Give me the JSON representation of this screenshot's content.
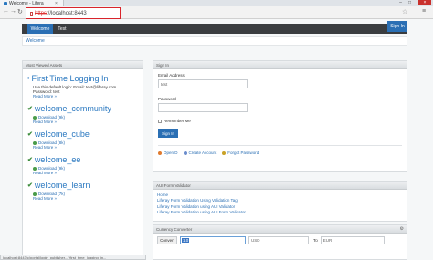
{
  "browser": {
    "tab_title": "Welcome - Lifera",
    "tab_close": "×",
    "url_prefix": "https",
    "url_rest": "://localhost:8443",
    "minimize": "–",
    "maximize": "□",
    "close": "×",
    "back": "←",
    "forward": "→",
    "reload": "↻",
    "star": "☆",
    "menu": "≡"
  },
  "dockbar": {
    "tabs": [
      "Welcome",
      "Test"
    ],
    "sign_in": "Sign In"
  },
  "breadcrumb": "Welcome",
  "assets": {
    "title": "Most Viewed Assets",
    "first_title": "First Time Logging In",
    "first_lines": [
      "Use this default login: Email: test@liferay.com",
      "Password: test"
    ],
    "read_more": "Read More »",
    "items": [
      {
        "title": "welcome_community",
        "download": "Download (9k)",
        "read_more": "Read More »"
      },
      {
        "title": "welcome_cube",
        "download": "Download (8k)",
        "read_more": "Read More »"
      },
      {
        "title": "welcome_ee",
        "download": "Download (9k)",
        "read_more": "Read More »"
      },
      {
        "title": "welcome_learn",
        "download": "Download (7k)",
        "read_more": "Read More »"
      }
    ]
  },
  "signin": {
    "title": "Sign In",
    "email_label": "Email Address",
    "email_value": "test",
    "password_label": "Password",
    "remember_label": "Remember Me",
    "button": "Sign In",
    "links": [
      "OpenID",
      "Create Account",
      "Forgot Password"
    ]
  },
  "validator": {
    "title": "AUI Form Validator",
    "links": [
      "Home",
      "Liferay Form Validation Using Validation Tag",
      "Liferay Form Validation using AUI Validator",
      "Liferay Form Validation using AUI Form Validator"
    ]
  },
  "currency": {
    "title": "Currency Converter",
    "convert": "Convert",
    "amount": "1.0",
    "from": "USD",
    "to_label": "To",
    "to": "EUR"
  },
  "status": "localhost:8443/c/portal/login_publisher...?first_time_logging_in..."
}
